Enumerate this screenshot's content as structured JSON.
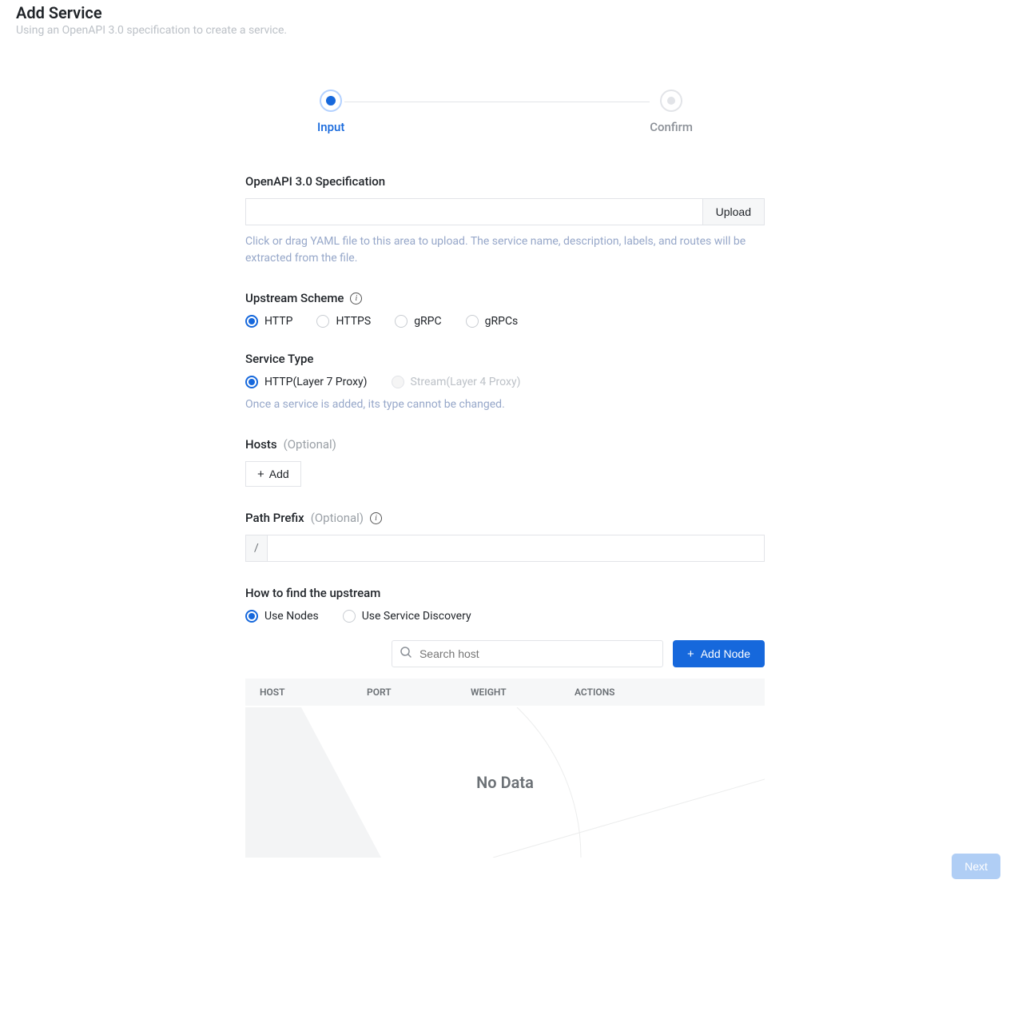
{
  "header": {
    "title": "Add Service",
    "subtitle": "Using an OpenAPI 3.0 specification to create a service."
  },
  "stepper": {
    "step1": "Input",
    "step2": "Confirm"
  },
  "openapi": {
    "label": "OpenAPI 3.0 Specification",
    "upload_btn": "Upload",
    "help": "Click or drag YAML file to this area to upload. The service name, description, labels, and routes will be extracted from the file."
  },
  "upstream_scheme": {
    "label": "Upstream Scheme",
    "options": [
      "HTTP",
      "HTTPS",
      "gRPC",
      "gRPCs"
    ]
  },
  "service_type": {
    "label": "Service Type",
    "opt1": "HTTP(Layer 7 Proxy)",
    "opt2": "Stream(Layer 4 Proxy)",
    "help": "Once a service is added, its type cannot be changed."
  },
  "hosts": {
    "label": "Hosts",
    "optional": "(Optional)",
    "add_btn": "Add"
  },
  "path_prefix": {
    "label": "Path Prefix",
    "optional": "(Optional)",
    "addon": "/"
  },
  "upstream_find": {
    "label": "How to find the upstream",
    "opt1": "Use Nodes",
    "opt2": "Use Service Discovery"
  },
  "nodes": {
    "search_placeholder": "Search host",
    "add_node_btn": "Add Node",
    "cols": {
      "host": "HOST",
      "port": "PORT",
      "weight": "WEIGHT",
      "actions": "ACTIONS"
    },
    "nodata": "No Data"
  },
  "footer": {
    "next": "Next"
  }
}
